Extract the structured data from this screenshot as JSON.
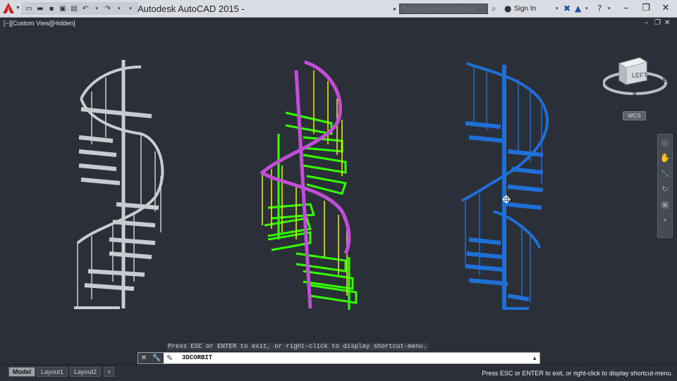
{
  "app": {
    "title": "Autodesk AutoCAD 2015 -"
  },
  "search": {
    "placeholder": "Type a keyword or phrase"
  },
  "signin": {
    "label": "Sign In"
  },
  "viewport": {
    "label": "[−][Custom View][Hidden]"
  },
  "viewcube": {
    "face": "LEFT",
    "compass": [
      "E",
      "S"
    ]
  },
  "wcs": {
    "label": "WCS"
  },
  "command": {
    "history": "Press ESC or ENTER to exit, or right-click to display shortcut-menu.",
    "current": "3DCORBIT"
  },
  "tabs": [
    {
      "label": "Model"
    },
    {
      "label": "Layout1"
    },
    {
      "label": "Layout2"
    },
    {
      "label": "+"
    }
  ],
  "status": {
    "message": "Press ESC or ENTER to exit, or right-click to display shortcut-menu."
  },
  "colors": {
    "background": "#2b3038",
    "stair_left": "#c8ccd0",
    "stair_middle_treads": "#33ff00",
    "stair_middle_rail": "#c24dd6",
    "stair_middle_balusters": "#f2f200",
    "stair_right": "#1e6fd6"
  },
  "icons": [
    "app-logo-icon",
    "new-icon",
    "open-icon",
    "save-icon",
    "save-as-icon",
    "print-icon",
    "undo-icon",
    "redo-icon",
    "binoculars-icon",
    "user-icon",
    "exchange-icon",
    "autodesk360-icon",
    "help-icon"
  ]
}
